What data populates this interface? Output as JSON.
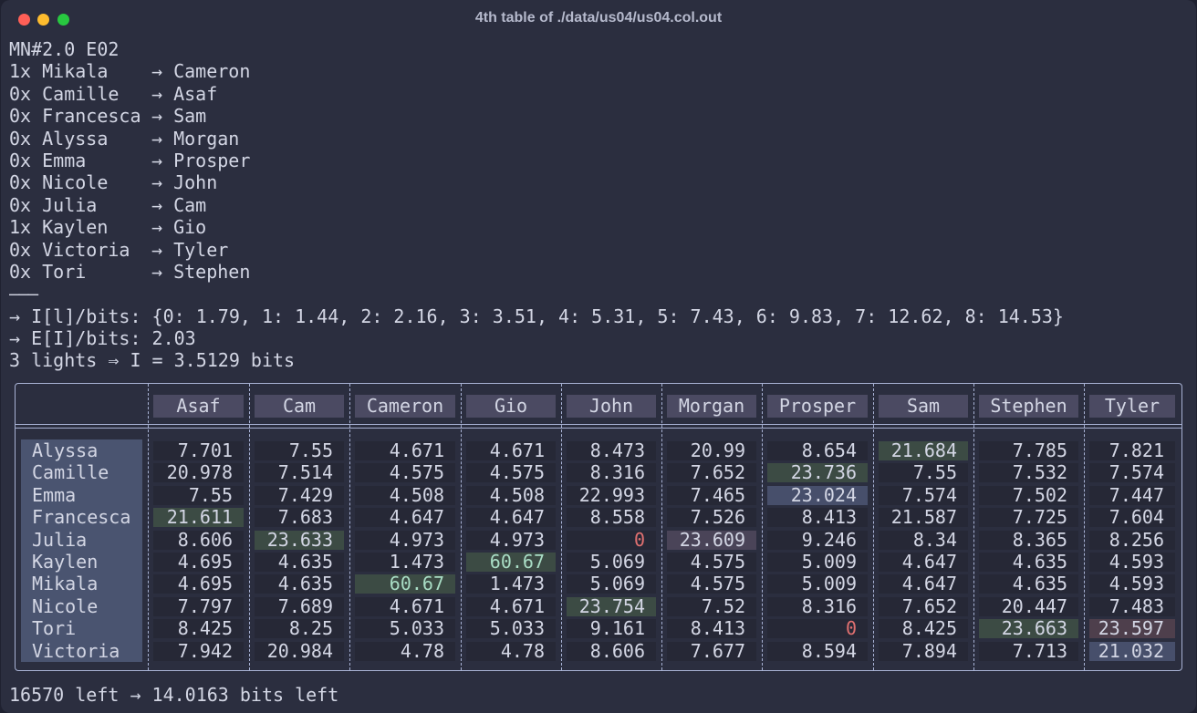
{
  "window": {
    "title": "4th table of ./data/us04/us04.col.out"
  },
  "terminal": {
    "header": "MN#2.0 E02",
    "matches": [
      {
        "count": "1x",
        "left": "Mikala",
        "right": "Cameron"
      },
      {
        "count": "0x",
        "left": "Camille",
        "right": "Asaf"
      },
      {
        "count": "0x",
        "left": "Francesca",
        "right": "Sam"
      },
      {
        "count": "0x",
        "left": "Alyssa",
        "right": "Morgan"
      },
      {
        "count": "0x",
        "left": "Emma",
        "right": "Prosper"
      },
      {
        "count": "0x",
        "left": "Nicole",
        "right": "John"
      },
      {
        "count": "0x",
        "left": "Julia",
        "right": "Cam"
      },
      {
        "count": "1x",
        "left": "Kaylen",
        "right": "Gio"
      },
      {
        "count": "0x",
        "left": "Victoria",
        "right": "Tyler"
      },
      {
        "count": "0x",
        "left": "Tori",
        "right": "Stephen"
      }
    ],
    "separator": "———",
    "info_bits": "→ I[l]/bits: {0: 1.79, 1: 1.44, 2: 2.16, 3: 3.51, 4: 5.31, 5: 7.43, 6: 9.83, 7: 12.62, 8: 14.53}",
    "expected_bits": "→ E[I]/bits: 2.03",
    "lights": "3 lights ⇒ I = 3.5129 bits",
    "footer": "16570 left → 14.0163 bits left"
  },
  "table": {
    "columns": [
      "Asaf",
      "Cam",
      "Cameron",
      "Gio",
      "John",
      "Morgan",
      "Prosper",
      "Sam",
      "Stephen",
      "Tyler"
    ],
    "rows": [
      {
        "name": "Alyssa",
        "values": [
          "7.701",
          "7.55",
          "4.671",
          "4.671",
          "8.473",
          "20.99",
          "8.654",
          "21.684",
          "7.785",
          "7.821"
        ]
      },
      {
        "name": "Camille",
        "values": [
          "20.978",
          "7.514",
          "4.575",
          "4.575",
          "8.316",
          "7.652",
          "23.736",
          "7.55",
          "7.532",
          "7.574"
        ]
      },
      {
        "name": "Emma",
        "values": [
          "7.55",
          "7.429",
          "4.508",
          "4.508",
          "22.993",
          "7.465",
          "23.024",
          "7.574",
          "7.502",
          "7.447"
        ]
      },
      {
        "name": "Francesca",
        "values": [
          "21.611",
          "7.683",
          "4.647",
          "4.647",
          "8.558",
          "7.526",
          "8.413",
          "21.587",
          "7.725",
          "7.604"
        ]
      },
      {
        "name": "Julia",
        "values": [
          "8.606",
          "23.633",
          "4.973",
          "4.973",
          "0",
          "23.609",
          "9.246",
          "8.34",
          "8.365",
          "8.256"
        ]
      },
      {
        "name": "Kaylen",
        "values": [
          "4.695",
          "4.635",
          "1.473",
          "60.67",
          "5.069",
          "4.575",
          "5.009",
          "4.647",
          "4.635",
          "4.593"
        ]
      },
      {
        "name": "Mikala",
        "values": [
          "4.695",
          "4.635",
          "60.67",
          "1.473",
          "5.069",
          "4.575",
          "5.009",
          "4.647",
          "4.635",
          "4.593"
        ]
      },
      {
        "name": "Nicole",
        "values": [
          "7.797",
          "7.689",
          "4.671",
          "4.671",
          "23.754",
          "7.52",
          "8.316",
          "7.652",
          "20.447",
          "7.483"
        ]
      },
      {
        "name": "Tori",
        "values": [
          "8.425",
          "8.25",
          "5.033",
          "5.033",
          "9.161",
          "8.413",
          "0",
          "8.425",
          "23.663",
          "23.597"
        ]
      },
      {
        "name": "Victoria",
        "values": [
          "7.942",
          "20.984",
          "4.78",
          "4.78",
          "8.606",
          "7.677",
          "8.594",
          "7.894",
          "7.713",
          "21.032"
        ]
      }
    ],
    "highlights": [
      {
        "row": 0,
        "col": 7,
        "style": "green"
      },
      {
        "row": 1,
        "col": 6,
        "style": "green"
      },
      {
        "row": 2,
        "col": 6,
        "style": "blue"
      },
      {
        "row": 3,
        "col": 0,
        "style": "green"
      },
      {
        "row": 4,
        "col": 1,
        "style": "green"
      },
      {
        "row": 4,
        "col": 5,
        "style": "purple"
      },
      {
        "row": 5,
        "col": 3,
        "style": "green-bright"
      },
      {
        "row": 6,
        "col": 2,
        "style": "green-bright"
      },
      {
        "row": 7,
        "col": 4,
        "style": "green"
      },
      {
        "row": 8,
        "col": 8,
        "style": "green"
      },
      {
        "row": 8,
        "col": 9,
        "style": "red"
      },
      {
        "row": 9,
        "col": 9,
        "style": "blue"
      }
    ],
    "zero_color": "#e07070"
  }
}
